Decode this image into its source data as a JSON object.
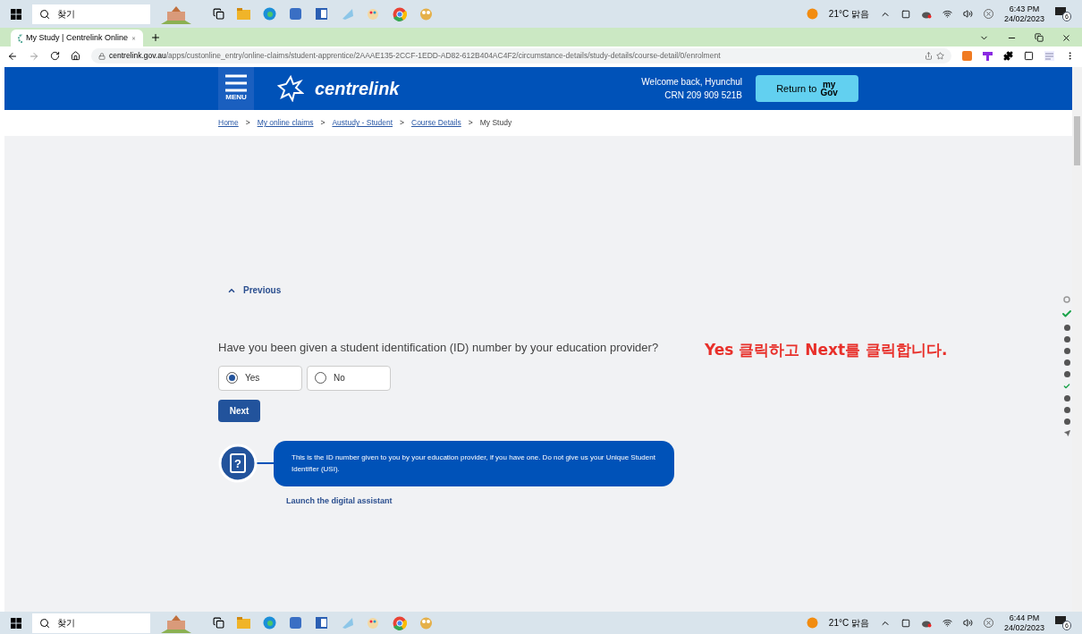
{
  "taskbar_top": {
    "search": "찾기",
    "weather": "21°C 맑음",
    "time": "6:43 PM",
    "date": "24/02/2023",
    "notifications": "6"
  },
  "browser": {
    "tab": {
      "title": "My Study | Centrelink Online",
      "selected": true
    },
    "url_host": "centrelink.gov.au",
    "url_path": "/apps/custonline_entry/online-claims/student-apprentice/2AAAE135-2CCF-1EDD-AD82-612B404AC4F2/circumstance-details/study-details/course-detail/0/enrolment"
  },
  "header": {
    "menu": "MENU",
    "logo": "centrelink",
    "welcome": "Welcome back, Hyunchul",
    "crn": "CRN 209 909 521B",
    "return_label": "Return to",
    "return_brand_top": "my",
    "return_brand_bottom": "Gov"
  },
  "breadcrumb_separator": ">",
  "breadcrumbs": [
    {
      "label": "Home",
      "link": true
    },
    {
      "label": "My online claims",
      "link": true
    },
    {
      "label": "Austudy - Student",
      "link": true
    },
    {
      "label": "Course Details",
      "link": true
    },
    {
      "label": "My Study",
      "link": false
    }
  ],
  "previous": "Previous",
  "question": "Have you been given a student identification (ID) number by your education provider?",
  "options": [
    {
      "label": "Yes",
      "selected": true
    },
    {
      "label": "No",
      "selected": false
    }
  ],
  "next": "Next",
  "help_icon_glyph": "?",
  "help_text": "This is the ID number given to you by your education provider, if you have one. Do not give us your Unique Student Identifier (USI).",
  "assistant_link": "Launch the digital assistant",
  "annotation": "Yes 클릭하고 Next를 클릭합니다.",
  "progress_steps": [
    {
      "kind": "empty"
    },
    {
      "kind": "done"
    },
    {
      "kind": "pending"
    },
    {
      "kind": "pending"
    },
    {
      "kind": "pending"
    },
    {
      "kind": "pending"
    },
    {
      "kind": "pending"
    },
    {
      "kind": "done-small"
    },
    {
      "kind": "pending"
    },
    {
      "kind": "pending"
    },
    {
      "kind": "pending"
    },
    {
      "kind": "submit"
    }
  ],
  "taskbar_bottom": {
    "search": "찾기",
    "weather": "21°C 맑음",
    "time": "6:44 PM",
    "date": "24/02/2023",
    "notifications": "6"
  }
}
